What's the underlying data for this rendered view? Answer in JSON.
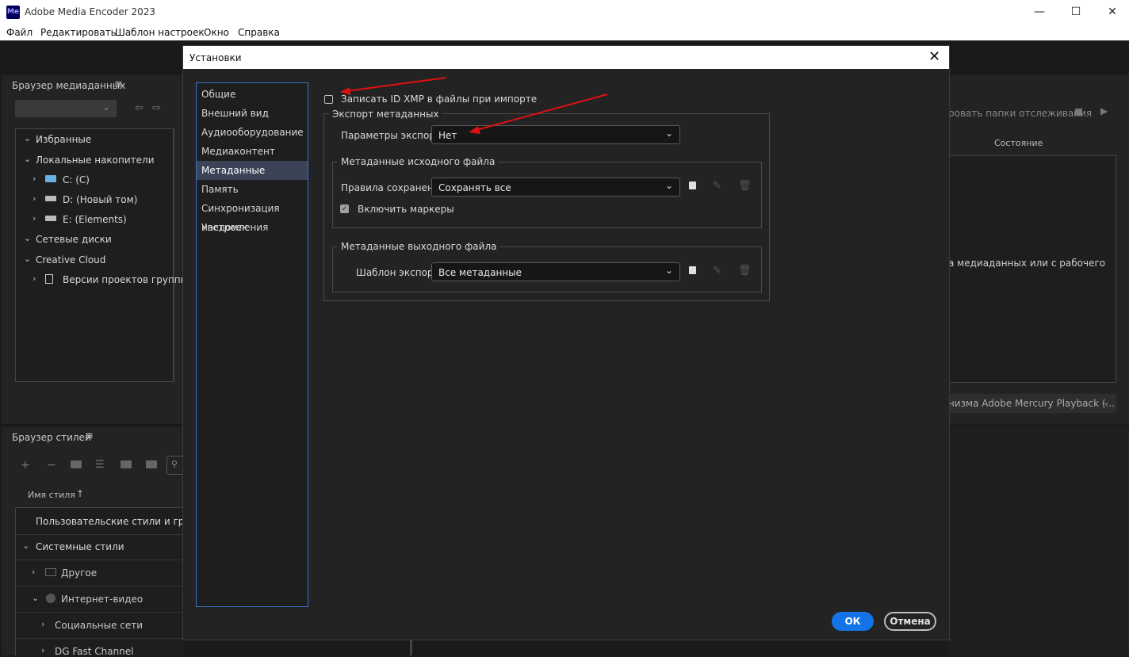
{
  "app": {
    "title": "Adobe Media Encoder 2023",
    "icon_text": "Me"
  },
  "window_controls": {
    "minimize": "—",
    "maximize": "☐",
    "close": "✕"
  },
  "menu": [
    "Файл",
    "Редактировать",
    "Шаблон настроек",
    "Окно",
    "Справка"
  ],
  "media_browser": {
    "title": "Браузер медиаданных",
    "items": [
      {
        "label": "Избранные",
        "chev": "⌄"
      },
      {
        "label": "Локальные накопители",
        "chev": "⌄"
      },
      {
        "label": "C: (C)",
        "chev": "›"
      },
      {
        "label": "D: (Новый том)",
        "chev": "›"
      },
      {
        "label": "E: (Elements)",
        "chev": "›"
      },
      {
        "label": "Сетевые диски",
        "chev": "⌄"
      },
      {
        "label": "Creative Cloud",
        "chev": "⌄"
      },
      {
        "label": "Версии проектов группы",
        "chev": "›"
      }
    ]
  },
  "style_browser": {
    "title": "Браузер стилей",
    "column": "Имя стиля",
    "items": [
      {
        "label": "Пользовательские стили и группы",
        "chev": ""
      },
      {
        "label": "Системные стили",
        "chev": "⌄"
      },
      {
        "label": "Другое",
        "chev": "›"
      },
      {
        "label": "Интернет-видео",
        "chev": "⌄"
      },
      {
        "label": "Социальные сети",
        "chev": "›"
      },
      {
        "label": "DG Fast Channel",
        "chev": "›"
      }
    ]
  },
  "right_panel": {
    "watch_label": "ровать папки отслеживания",
    "status_header": "Состояние",
    "hint": "а медиаданных или с рабочего",
    "renderer": "низма Adobe Mercury Playback (..."
  },
  "dialog": {
    "title": "Установки",
    "nav": [
      "Общие",
      "Внешний вид",
      "Аудиооборудование",
      "Медиаконтент",
      "Метаданные",
      "Память",
      "Синхронизация настроек",
      "Уведомления"
    ],
    "selected_nav": "Метаданные",
    "write_xmp_label": "Записать ID XMP в файлы при импорте",
    "export_group_title": "Экспорт метаданных",
    "export_params_label": "Параметры экспорта:",
    "export_params_value": "Нет",
    "source_group_title": "Метаданные исходного файла",
    "save_rules_label": "Правила сохранения:",
    "save_rules_value": "Сохранять все",
    "include_markers_label": "Включить маркеры",
    "output_group_title": "Метаданные выходного файла",
    "export_template_label": "Шаблон экспорта:",
    "export_template_value": "Все метаданные",
    "ok_label": "ОК",
    "cancel_label": "Отмена"
  }
}
